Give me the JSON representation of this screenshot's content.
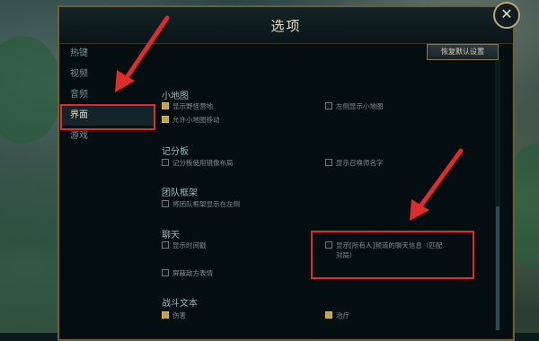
{
  "dialog": {
    "title": "选项",
    "close_glyph": "✕",
    "reset_label": "恢复默认设置"
  },
  "sidebar": {
    "items": [
      {
        "label": "热键"
      },
      {
        "label": "视频"
      },
      {
        "label": "音频"
      },
      {
        "label": "界面"
      },
      {
        "label": "游戏"
      }
    ],
    "active_index": 3
  },
  "sections": {
    "minimap": {
      "title": "小地图",
      "options": [
        {
          "label": "显示野怪营地",
          "checked": true
        },
        {
          "label": "左侧显示小地图",
          "checked": false
        },
        {
          "label": "允许小地图移动",
          "checked": true
        }
      ]
    },
    "scoreboard": {
      "title": "记分板",
      "options": [
        {
          "label": "记分板使用镜像布局",
          "checked": false
        },
        {
          "label": "显示召唤师名字",
          "checked": false
        }
      ]
    },
    "team_frame": {
      "title": "团队框架",
      "options": [
        {
          "label": "将团队框架显示在左侧",
          "checked": false
        }
      ]
    },
    "chat": {
      "title": "聊天",
      "options": [
        {
          "label": "显示时间戳",
          "checked": false
        },
        {
          "label": "显示[所有人]频道的聊天信息（匹配对局）",
          "line1": "显示[所有人]频道的聊天信息（匹配",
          "line2": "对局）",
          "checked": false
        },
        {
          "label": "屏蔽敌方表情",
          "checked": false
        }
      ]
    },
    "combat_text": {
      "title": "战斗文本",
      "options": [
        {
          "label": "伤害",
          "checked": true
        },
        {
          "label": "治疗",
          "checked": true
        }
      ]
    }
  },
  "colors": {
    "accent_gold": "#c8a33c",
    "annotation_red": "#e02b2b"
  }
}
